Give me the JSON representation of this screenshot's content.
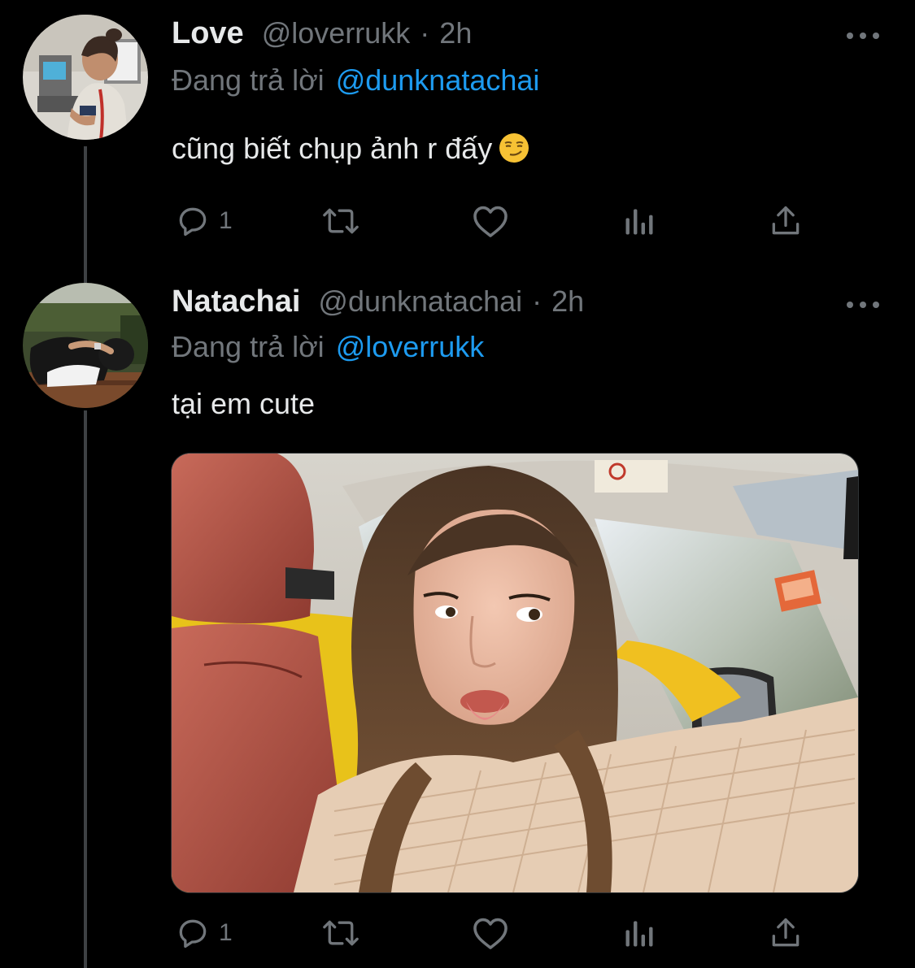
{
  "tweets": [
    {
      "display_name": "Love",
      "handle": "@loverrukk",
      "separator": "·",
      "time": "2h",
      "reply_prefix": "Đang trả lời",
      "reply_to": "@dunknatachai",
      "text": "cũng biết chụp ảnh r đấy",
      "emoji": "smirking-face",
      "reply_count": "1"
    },
    {
      "display_name": "Natachai",
      "handle": "@dunknatachai",
      "separator": "·",
      "time": "2h",
      "reply_prefix": "Đang trả lời",
      "reply_to": "@loverrukk",
      "text": "tại em cute",
      "reply_count": "1",
      "media": "photo-girl-in-car"
    }
  ],
  "icons": [
    "reply-icon",
    "retweet-icon",
    "like-icon",
    "analytics-icon",
    "share-icon",
    "more-icon"
  ],
  "colors": {
    "background": "#000000",
    "primary_text": "#e7e9ea",
    "secondary_text": "#71767b",
    "link": "#1d9bf0",
    "thread_line": "#3e4144"
  }
}
